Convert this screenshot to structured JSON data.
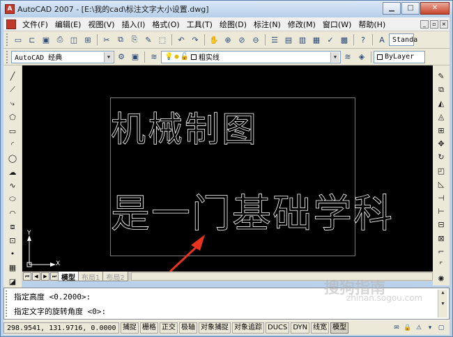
{
  "window": {
    "title": "AutoCAD 2007 - [E:\\我的cad\\标注文字大小设置.dwg]"
  },
  "menu": {
    "items": [
      "文件(F)",
      "编辑(E)",
      "视图(V)",
      "插入(I)",
      "格式(O)",
      "工具(T)",
      "绘图(D)",
      "标注(N)",
      "修改(M)",
      "窗口(W)",
      "帮助(H)"
    ]
  },
  "toolbar": {
    "text_style": "Standa",
    "workspace": "AutoCAD 经典",
    "layer": "粗实线",
    "layer_state": "ByLayer"
  },
  "drawing": {
    "text_line1": "机械制图",
    "text_line2": "是一门基础学科",
    "ucs_x": "X",
    "ucs_y": "Y"
  },
  "tabs": {
    "items": [
      "模型",
      "布局1",
      "布局2"
    ],
    "active": "模型"
  },
  "command": {
    "line1": "指定高度 <0.2000>:",
    "line2": "指定文字的旋转角度 <0>:"
  },
  "status": {
    "coords": "298.9541, 131.9716, 0.0000",
    "buttons": [
      "捕捉",
      "栅格",
      "正交",
      "极轴",
      "对象捕捉",
      "对象追踪",
      "DUCS",
      "DYN",
      "线宽",
      "模型"
    ]
  },
  "watermark": {
    "brand": "搜狗指南",
    "url": "zhinan.sogou.com"
  },
  "colors": {
    "canvas": "#000000",
    "cad_text": "#ffffff",
    "annotation_arrow": "#e8331f"
  }
}
